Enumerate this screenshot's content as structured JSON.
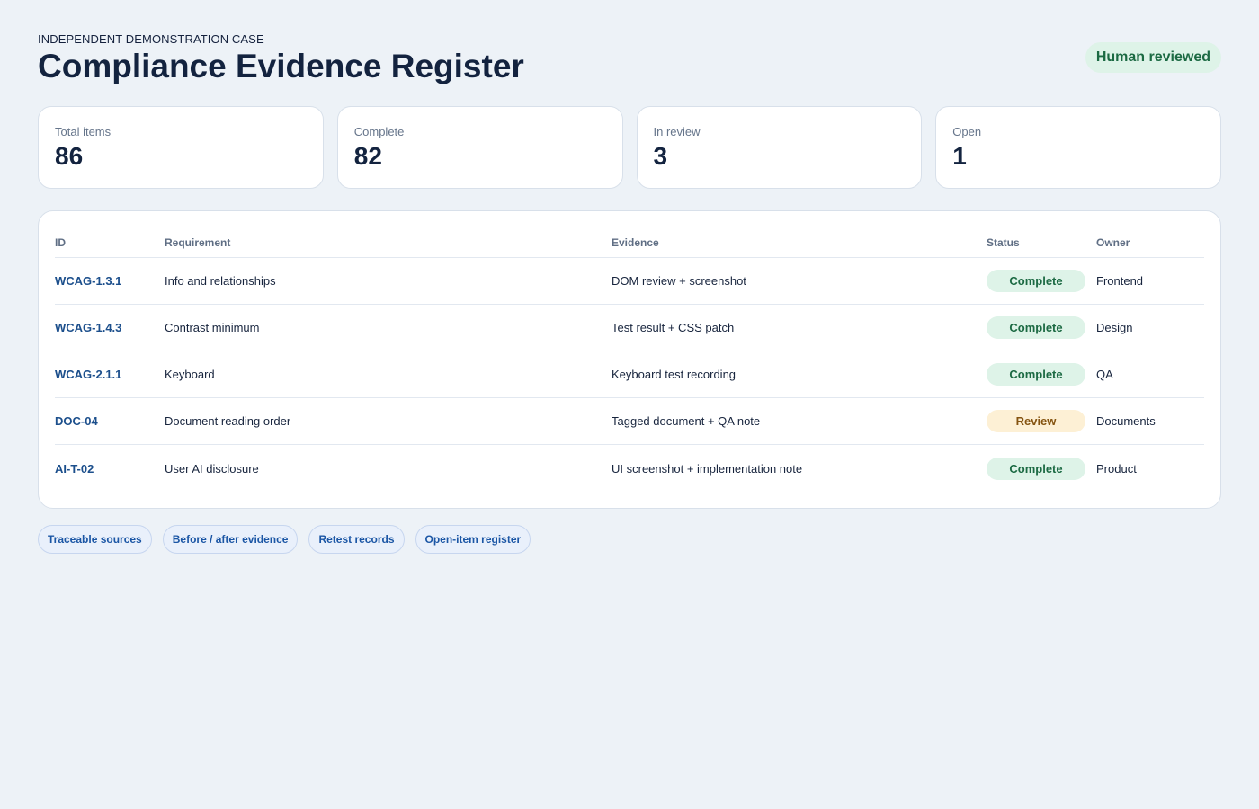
{
  "header": {
    "eyebrow": "INDEPENDENT DEMONSTRATION CASE",
    "title": "Compliance Evidence Register",
    "badge": "Human reviewed"
  },
  "stats": [
    {
      "label": "Total items",
      "value": "86"
    },
    {
      "label": "Complete",
      "value": "82"
    },
    {
      "label": "In review",
      "value": "3"
    },
    {
      "label": "Open",
      "value": "1"
    }
  ],
  "table": {
    "columns": [
      "ID",
      "Requirement",
      "Evidence",
      "Status",
      "Owner"
    ],
    "rows": [
      {
        "id": "WCAG-1.3.1",
        "requirement": "Info and relationships",
        "evidence": "DOM review + screenshot",
        "status": "Complete",
        "owner": "Frontend"
      },
      {
        "id": "WCAG-1.4.3",
        "requirement": "Contrast minimum",
        "evidence": "Test result + CSS patch",
        "status": "Complete",
        "owner": "Design"
      },
      {
        "id": "WCAG-2.1.1",
        "requirement": "Keyboard",
        "evidence": "Keyboard test recording",
        "status": "Complete",
        "owner": "QA"
      },
      {
        "id": "DOC-04",
        "requirement": "Document reading order",
        "evidence": "Tagged document + QA note",
        "status": "Review",
        "owner": "Documents"
      },
      {
        "id": "AI-T-02",
        "requirement": "User AI disclosure",
        "evidence": "UI screenshot + implementation note",
        "status": "Complete",
        "owner": "Product"
      }
    ]
  },
  "chips": [
    "Traceable sources",
    "Before / after evidence",
    "Retest records",
    "Open-item register"
  ],
  "colors": {
    "background": "#edf2f7",
    "complete_bg": "#def3e8",
    "complete_text": "#1c6a43",
    "review_bg": "#fdf0d5",
    "review_text": "#855411",
    "link": "#1c4f8c",
    "chip_text": "#1b56a5"
  }
}
